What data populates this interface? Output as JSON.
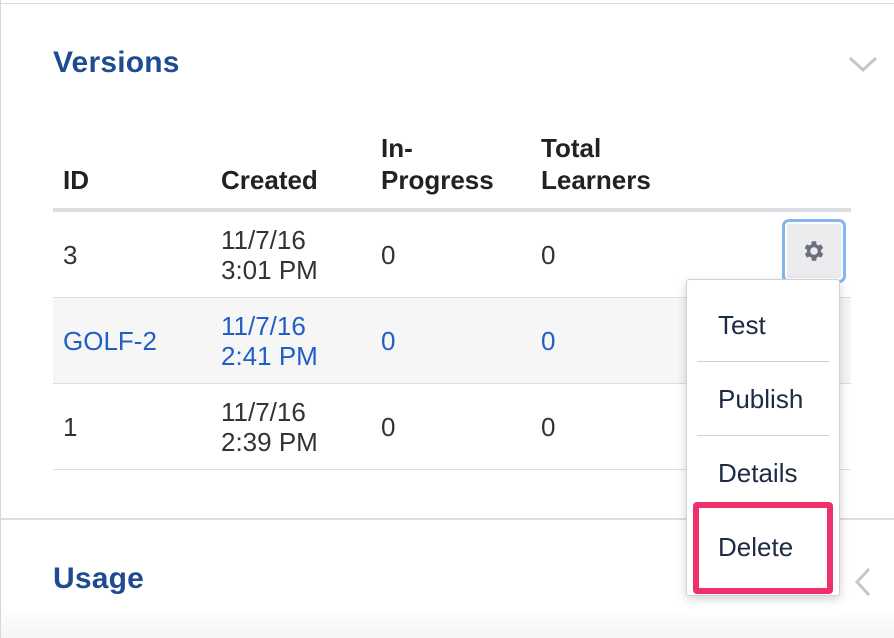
{
  "versions_section": {
    "title": "Versions",
    "columns": [
      "ID",
      "Created",
      "In-\nProgress",
      "Total\nLearners"
    ],
    "rows": [
      {
        "id": "3",
        "created": "11/7/16\n3:01 PM",
        "in_progress": "0",
        "total_learners": "0",
        "highlighted": false
      },
      {
        "id": "GOLF-2",
        "created": "11/7/16\n2:41 PM",
        "in_progress": "0",
        "total_learners": "0",
        "highlighted": true
      },
      {
        "id": "1",
        "created": "11/7/16\n2:39 PM",
        "in_progress": "0",
        "total_learners": "0",
        "highlighted": false
      }
    ],
    "collapse_icon": "chevron-down-icon"
  },
  "actions_menu": {
    "trigger_icon": "gear-icon",
    "items": [
      "Test",
      "Publish",
      "Details",
      "Delete"
    ],
    "highlighted_item": "Delete"
  },
  "usage_section": {
    "title": "Usage",
    "expand_icon": "chevron-left-icon"
  },
  "colors": {
    "title": "#1f4c91",
    "link": "#1f5fc6",
    "highlight_box": "#f0306a",
    "focus_ring": "#86b6ef"
  }
}
